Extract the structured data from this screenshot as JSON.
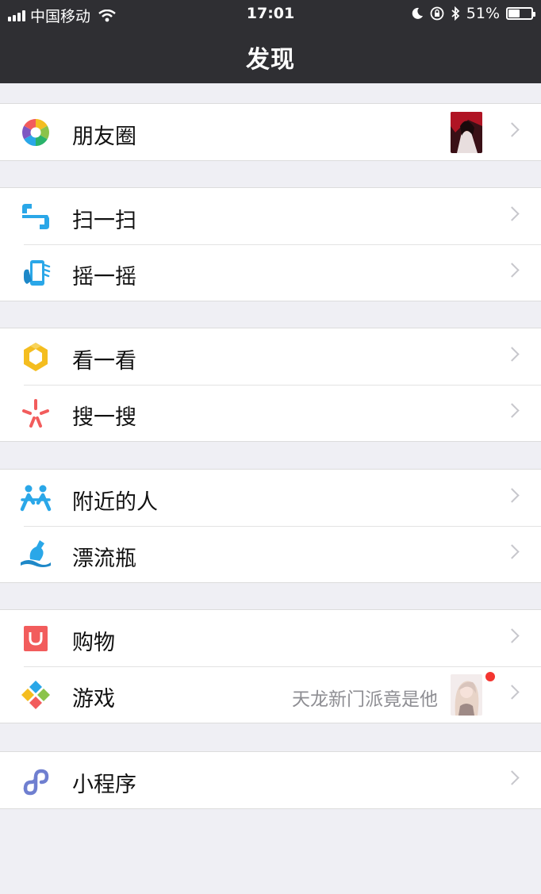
{
  "status": {
    "carrier": "中国移动",
    "time": "17:01",
    "battery": "51%",
    "battery_level": 0.51
  },
  "nav": {
    "title": "发现"
  },
  "items": {
    "moments": {
      "label": "朋友圈"
    },
    "scan": {
      "label": "扫一扫"
    },
    "shake": {
      "label": "摇一摇"
    },
    "top_stories": {
      "label": "看一看"
    },
    "search": {
      "label": "搜一搜"
    },
    "nearby": {
      "label": "附近的人"
    },
    "bottle": {
      "label": "漂流瓶"
    },
    "shopping": {
      "label": "购物"
    },
    "games": {
      "label": "游戏",
      "subtext": "天龙新门派竟是他"
    },
    "mini_programs": {
      "label": "小程序"
    }
  },
  "icons": {
    "moments": "camera-aperture-icon",
    "scan": "scan-icon",
    "shake": "shake-phone-icon",
    "top_stories": "top-stories-icon",
    "search": "search-sparkle-icon",
    "nearby": "people-nearby-icon",
    "bottle": "drift-bottle-icon",
    "shopping": "shopping-bag-icon",
    "games": "game-diamond-icon",
    "mini_programs": "mini-program-icon"
  },
  "colors": {
    "header_bg": "#2f2f33",
    "page_bg": "#efeff4",
    "badge": "#f43530",
    "scan_blue": "#2aa7e8",
    "shop_red": "#f25c5c",
    "star_yellow": "#f4bd1f"
  }
}
